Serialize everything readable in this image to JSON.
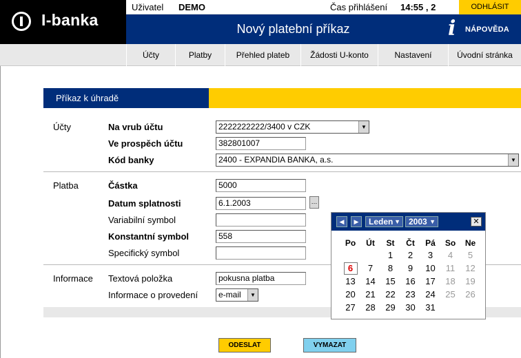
{
  "app": {
    "logo_text": "I-banka"
  },
  "userbar": {
    "user_label": "Uživatel",
    "user_name": "DEMO",
    "login_time_label": "Čas přihlášení",
    "login_time": "14:55 , 2",
    "logout_label": "ODHLÁSIT"
  },
  "header": {
    "title": "Nový platební příkaz",
    "help_label": "NÁPOVĚDA"
  },
  "nav": {
    "items": [
      {
        "label": "Účty"
      },
      {
        "label": "Platby"
      },
      {
        "label": "Přehled plateb"
      },
      {
        "label": "Žádosti U-konto"
      },
      {
        "label": "Nastavení"
      },
      {
        "label": "Úvodní stránka"
      }
    ]
  },
  "form": {
    "header": "Příkaz k úhradě",
    "sections": {
      "accounts": "Účty",
      "payment": "Platba",
      "info": "Informace"
    },
    "debit_account": {
      "label": "Na vrub účtu",
      "value": "2222222222/3400 v CZK"
    },
    "credit_account": {
      "label": "Ve prospěch účtu",
      "value": "382801007"
    },
    "bank_code": {
      "label": "Kód banky",
      "value": "2400 - EXPANDIA BANKA, a.s."
    },
    "amount": {
      "label": "Částka",
      "value": "5000"
    },
    "due_date": {
      "label": "Datum splatnosti",
      "value": "6.1.2003"
    },
    "variable_symbol": {
      "label": "Variabilní symbol",
      "value": ""
    },
    "constant_symbol": {
      "label": "Konstantní symbol",
      "value": "558"
    },
    "specific_symbol": {
      "label": "Specifický symbol",
      "value": ""
    },
    "text_item": {
      "label": "Textová položka",
      "value": "pokusna platba"
    },
    "execution_info": {
      "label": "Informace o provedení",
      "value": "e-mail"
    }
  },
  "calendar": {
    "month": "Leden",
    "year": "2003",
    "weekdays": [
      "Po",
      "Út",
      "St",
      "Čt",
      "Pá",
      "So",
      "Ne"
    ],
    "selected_day": "6",
    "weeks": [
      [
        "",
        "",
        "1",
        "2",
        "3",
        "4",
        "5"
      ],
      [
        "6",
        "7",
        "8",
        "9",
        "10",
        "11",
        "12"
      ],
      [
        "13",
        "14",
        "15",
        "16",
        "17",
        "18",
        "19"
      ],
      [
        "20",
        "21",
        "22",
        "23",
        "24",
        "25",
        "26"
      ],
      [
        "27",
        "28",
        "29",
        "30",
        "31",
        "",
        ""
      ]
    ]
  },
  "actions": {
    "send_label": "ODESLAT",
    "clear_label": "VYMAZAT"
  },
  "colors": {
    "brand_blue": "#002d7a",
    "accent_yellow": "#ffcc00",
    "button_blue": "#80d0ee"
  },
  "icons": {
    "logo": "power-icon",
    "help": "info-icon",
    "calendar": "calendar-icon",
    "close": "close-icon"
  }
}
